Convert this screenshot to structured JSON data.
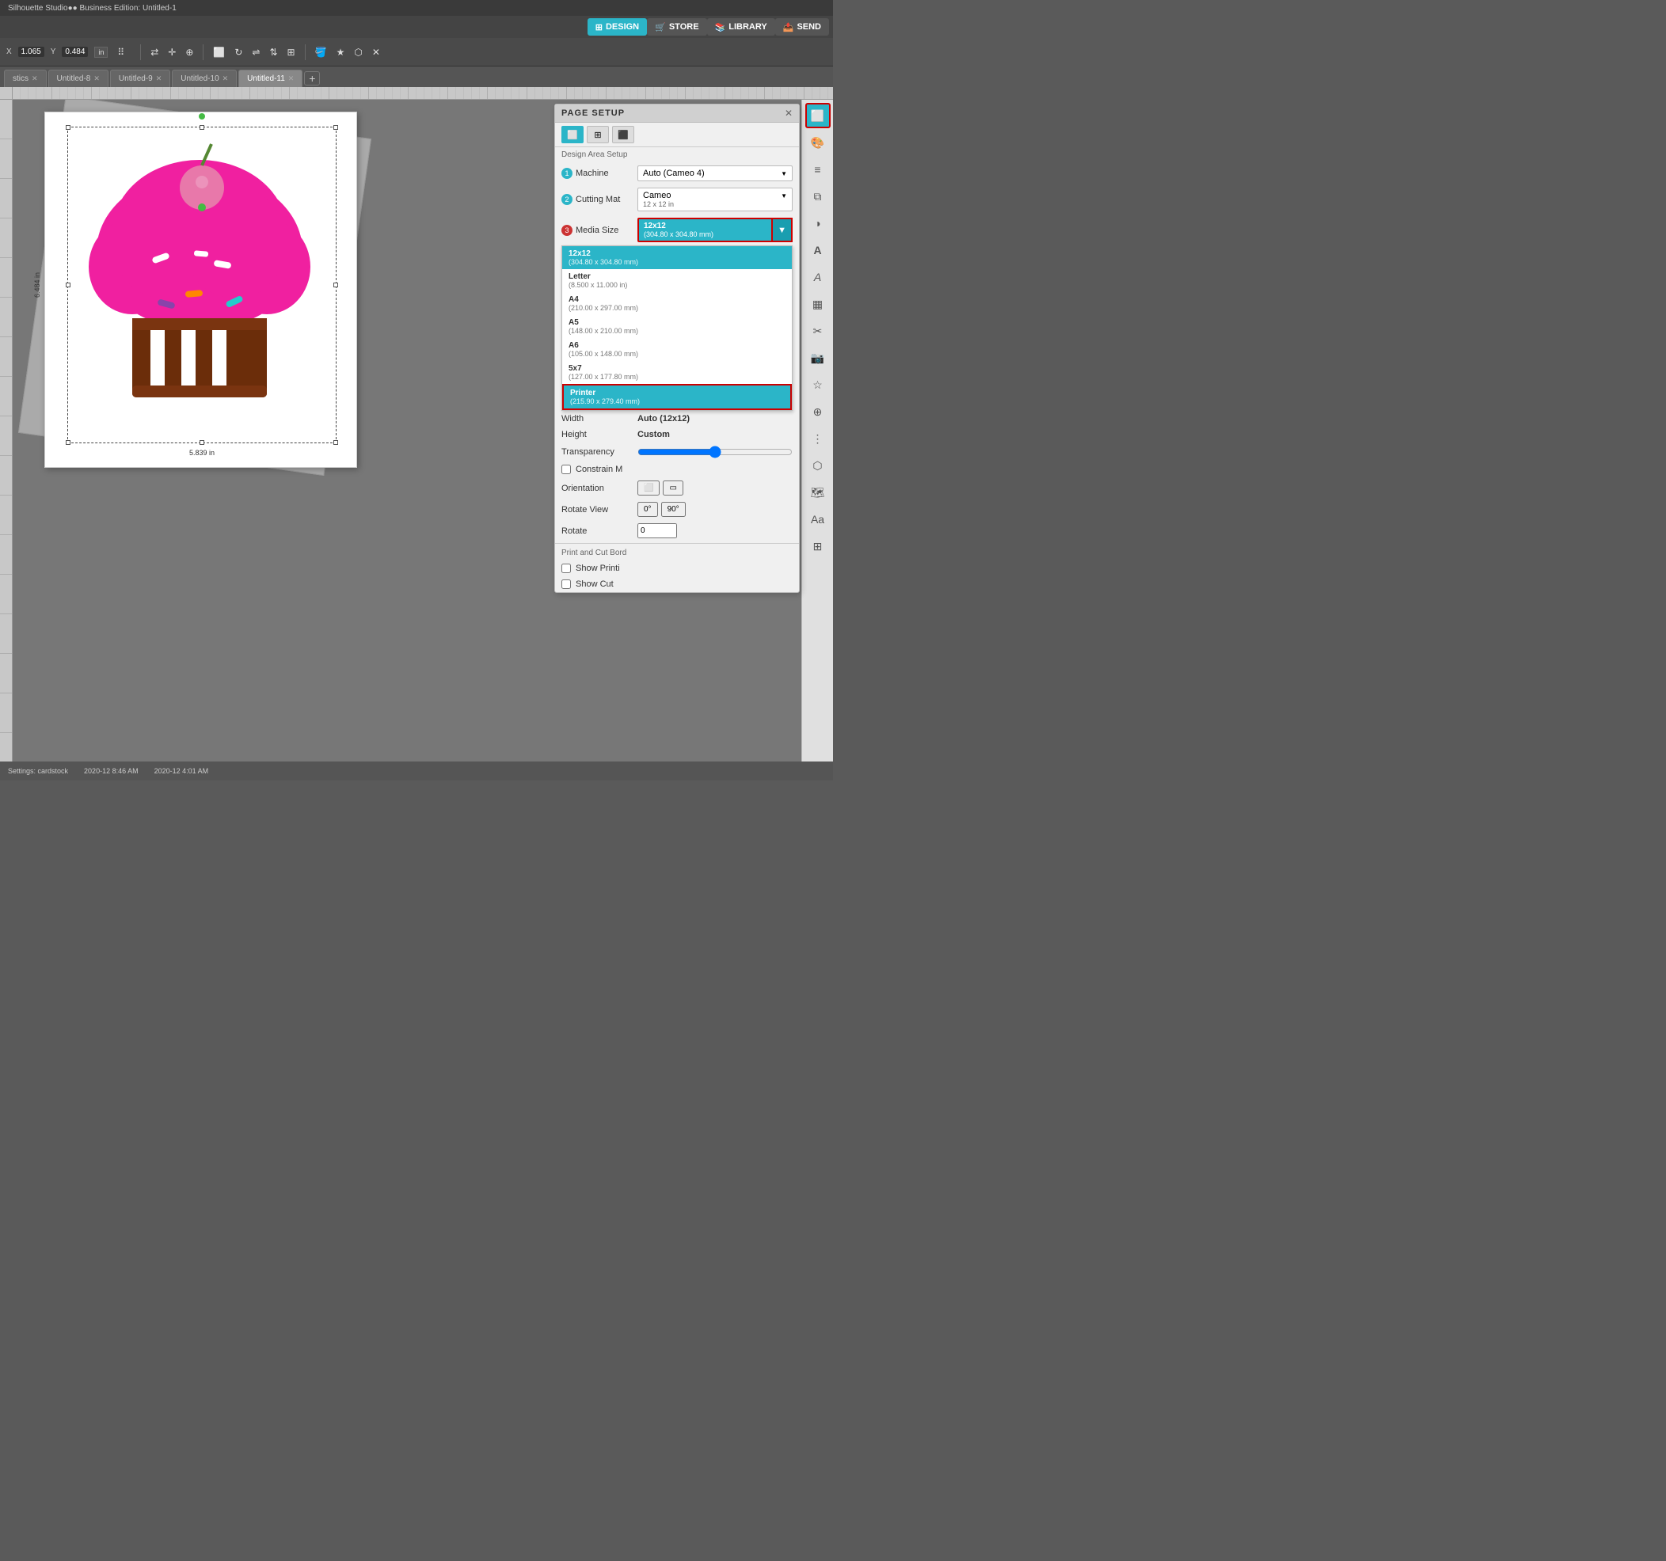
{
  "app": {
    "title": "Silhouette Studio●● Business Edition: Untitled-1"
  },
  "nav": {
    "design_label": "DESIGN",
    "store_label": "STORE",
    "library_label": "LIBRARY",
    "send_label": "SEND"
  },
  "toolbar": {
    "x_label": "X",
    "x_value": "1.065",
    "y_label": "Y",
    "y_value": "0.484",
    "units": "in"
  },
  "tabs": [
    {
      "id": "statistics",
      "label": "stics",
      "active": false,
      "closable": true
    },
    {
      "id": "untitled8",
      "label": "Untitled-8",
      "active": false,
      "closable": true
    },
    {
      "id": "untitled9",
      "label": "Untitled-9",
      "active": false,
      "closable": true
    },
    {
      "id": "untitled10",
      "label": "Untitled-10",
      "active": false,
      "closable": true
    },
    {
      "id": "untitled11",
      "label": "Untitled-11",
      "active": true,
      "closable": true
    }
  ],
  "page_setup": {
    "title": "PAGE SETUP",
    "section_label": "Design Area Setup",
    "machine": {
      "num": "1",
      "label": "Machine",
      "value": "Auto (Cameo 4)"
    },
    "cutting_mat": {
      "num": "2",
      "label": "Cutting Mat",
      "value": "Cameo",
      "sub": "12 x 12 in"
    },
    "media_size": {
      "num": "3",
      "label": "Media Size",
      "value": "12x12",
      "sub": "(304.80 x 304.80 mm)"
    },
    "width": {
      "label": "Width",
      "value": "Auto (12x12)"
    },
    "height": {
      "label": "Height",
      "value": "Custom"
    },
    "transparency": {
      "label": "Transparency"
    },
    "constrain": {
      "label": "Constrain M"
    },
    "orientation": {
      "label": "Orientation"
    },
    "rotate_view": {
      "label": "Rotate View"
    },
    "rotate": {
      "label": "Rotate"
    },
    "print_cut_border_label": "Print and Cut Bord",
    "show_print": {
      "label": "Show Printi"
    },
    "show_cut": {
      "label": "Show Cut"
    },
    "dropdown_items": [
      {
        "name": "12x12",
        "sub": "(304.80 x 304.80 mm)",
        "selected": true,
        "highlighted": false
      },
      {
        "name": "Letter",
        "sub": "(8.500 x 11.000 in)",
        "selected": false,
        "highlighted": false
      },
      {
        "name": "A4",
        "sub": "(210.00 x 297.00 mm)",
        "selected": false,
        "highlighted": false
      },
      {
        "name": "A5",
        "sub": "(148.00 x 210.00 mm)",
        "selected": false,
        "highlighted": false
      },
      {
        "name": "A6",
        "sub": "(105.00 x 148.00 mm)",
        "selected": false,
        "highlighted": false
      },
      {
        "name": "5x7",
        "sub": "(127.00 x 177.80 mm)",
        "selected": false,
        "highlighted": false
      },
      {
        "name": "Printer",
        "sub": "(215.90 x 279.40 mm)",
        "selected": false,
        "highlighted": true
      }
    ]
  },
  "canvas": {
    "width_label": "5.839 in",
    "height_label": "6.484 in"
  },
  "status_bar": {
    "text": "Settings: cardstock",
    "datetime1": "2020-12  8:46 AM",
    "datetime2": "2020-12  4:01 AM"
  },
  "sidebar_icons": [
    {
      "name": "page-setup-icon",
      "symbol": "⊞",
      "active": true
    },
    {
      "name": "color-icon",
      "symbol": "🎨",
      "active": false
    },
    {
      "name": "lines-icon",
      "symbol": "≡",
      "active": false
    },
    {
      "name": "layers-icon",
      "symbol": "⧉",
      "active": false
    },
    {
      "name": "contrast-icon",
      "symbol": "◑",
      "active": false
    },
    {
      "name": "text-icon",
      "symbol": "A",
      "active": false
    },
    {
      "name": "font-icon",
      "symbol": "∫",
      "active": false
    },
    {
      "name": "chart-icon",
      "symbol": "▦",
      "active": false
    },
    {
      "name": "scissors-icon",
      "symbol": "✂",
      "active": false
    },
    {
      "name": "camera-icon",
      "symbol": "📷",
      "active": false
    },
    {
      "name": "star-icon",
      "symbol": "☆",
      "active": false
    },
    {
      "name": "puzzle-icon",
      "symbol": "⊕",
      "active": false
    },
    {
      "name": "dots-icon",
      "symbol": "⋮⋮",
      "active": false
    },
    {
      "name": "box3d-icon",
      "symbol": "⬡",
      "active": false
    },
    {
      "name": "map-icon",
      "symbol": "🗺",
      "active": false
    },
    {
      "name": "textformat-icon",
      "symbol": "Aa",
      "active": false
    },
    {
      "name": "grid-icon",
      "symbol": "⊞",
      "active": false
    }
  ]
}
